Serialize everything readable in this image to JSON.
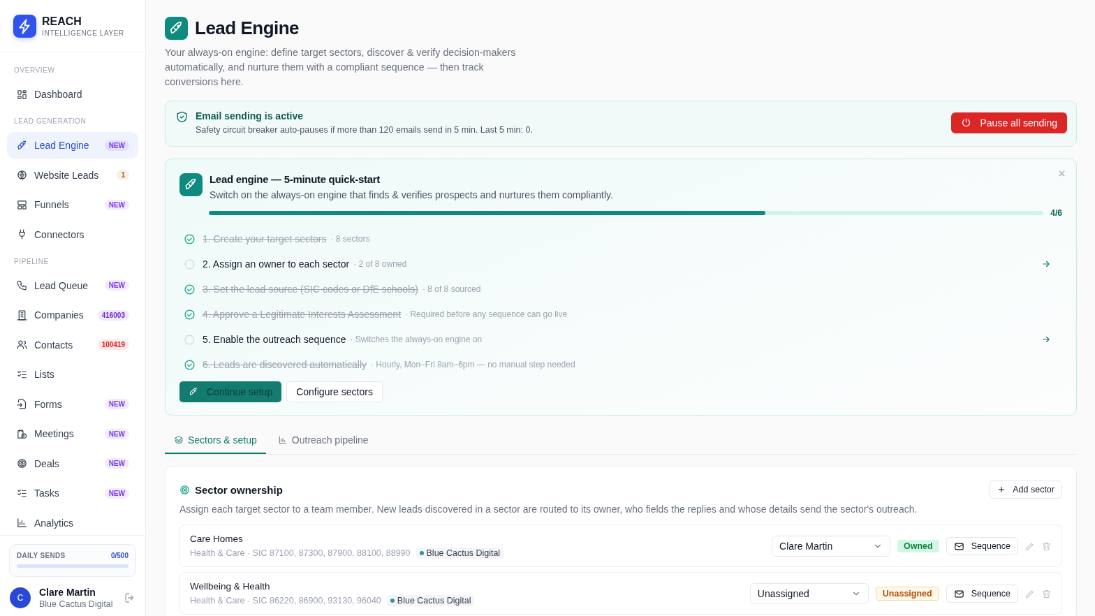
{
  "brand": {
    "name": "REACH",
    "tagline": "INTELLIGENCE LAYER"
  },
  "nav": [
    {
      "heading": "OVERVIEW",
      "items": [
        {
          "label": "Dashboard",
          "selected": false
        }
      ]
    },
    {
      "heading": "LEAD GENERATION",
      "items": [
        {
          "label": "Lead Engine",
          "selected": true,
          "badge": {
            "text": "NEW",
            "color": "#7c3aed"
          }
        },
        {
          "label": "Website Leads",
          "selected": false,
          "badge": {
            "text": "1",
            "color": "#a16207"
          }
        },
        {
          "label": "Funnels",
          "selected": false,
          "badge": {
            "text": "NEW",
            "color": "#7c3aed"
          }
        },
        {
          "label": "Connectors",
          "selected": false
        }
      ]
    },
    {
      "heading": "PIPELINE",
      "items": [
        {
          "label": "Lead Queue",
          "selected": false,
          "badge": {
            "text": "NEW",
            "color": "#7c3aed"
          }
        },
        {
          "label": "Companies",
          "selected": false,
          "badge": {
            "text": "416003",
            "color": "#6d28d9"
          }
        },
        {
          "label": "Contacts",
          "selected": false,
          "badge": {
            "text": "100419",
            "color": "#dc2626"
          }
        },
        {
          "label": "Lists",
          "selected": false
        },
        {
          "label": "Forms",
          "selected": false,
          "badge": {
            "text": "NEW",
            "color": "#7c3aed"
          }
        },
        {
          "label": "Meetings",
          "selected": false,
          "badge": {
            "text": "NEW",
            "color": "#7c3aed"
          }
        },
        {
          "label": "Deals",
          "selected": false,
          "badge": {
            "text": "NEW",
            "color": "#7c3aed"
          }
        },
        {
          "label": "Tasks",
          "selected": false,
          "badge": {
            "text": "NEW",
            "color": "#7c3aed"
          }
        },
        {
          "label": "Analytics",
          "selected": false
        }
      ]
    }
  ],
  "daily_sends": {
    "label": "DAILY SENDS",
    "value": "0/500",
    "level": 0
  },
  "user": {
    "initial": "C",
    "name": "Clare Martin",
    "org": "Blue Cactus Digital"
  },
  "page": {
    "title": "Lead Engine",
    "description": "Your always-on engine: define target sectors, discover & verify decision-makers automatically, and nurture them with a compliant sequence — then track conversions here."
  },
  "sending_status": {
    "title": "Email sending is active",
    "detail": "Safety circuit breaker auto-pauses if more than 120 emails send in 5 min. Last 5 min: 0.",
    "button": "Pause all sending"
  },
  "quickstart": {
    "title": "Lead engine — 5-minute quick-start",
    "subtitle": "Switch on the always-on engine that finds & verifies prospects and nurtures them compliantly.",
    "level": 0.667,
    "progress": "4/6",
    "steps": [
      {
        "title": "1. Create your target sectors",
        "note": "· 8 sectors",
        "done": true
      },
      {
        "title": "2. Assign an owner to each sector",
        "note": "· 2 of 8 owned",
        "done": false
      },
      {
        "title": "3. Set the lead source (SIC codes or DfE schools)",
        "note": "· 8 of 8 sourced",
        "done": true
      },
      {
        "title": "4. Approve a Legitimate Interests Assessment",
        "note": "· Required before any sequence can go live",
        "done": true
      },
      {
        "title": "5. Enable the outreach sequence",
        "note": "· Switches the always-on engine on",
        "done": false
      },
      {
        "title": "6. Leads are discovered automatically",
        "note": "· Hourly, Mon–Fri 8am–6pm — no manual step needed",
        "done": true
      }
    ],
    "primary_button": "Continue setup",
    "secondary_button": "Configure sectors"
  },
  "tabs": [
    {
      "label": "Sectors & setup",
      "selected": true
    },
    {
      "label": "Outreach pipeline",
      "selected": false
    }
  ],
  "sector_ownership": {
    "title": "Sector ownership",
    "add_button": "Add sector",
    "description": "Assign each target sector to a team member. New leads discovered in a sector are routed to its owner, who fields the replies and whose details send the sector's outreach.",
    "rows": [
      {
        "name": "Care Homes",
        "meta": "Health & Care · SIC 87100, 87300, 87900, 88100, 88990",
        "tag": "Blue Cactus Digital",
        "owner": "Clare Martin",
        "status": {
          "text": "Owned",
          "kind": "owned"
        },
        "sequence": "Sequence"
      },
      {
        "name": "Wellbeing & Health",
        "meta": "Health & Care · SIC 86220, 86900, 93130, 96040",
        "tag": "Blue Cactus Digital",
        "owner": "Unassigned",
        "status": {
          "text": "Unassigned",
          "kind": "unassigned"
        },
        "sequence": "Sequence"
      }
    ]
  }
}
